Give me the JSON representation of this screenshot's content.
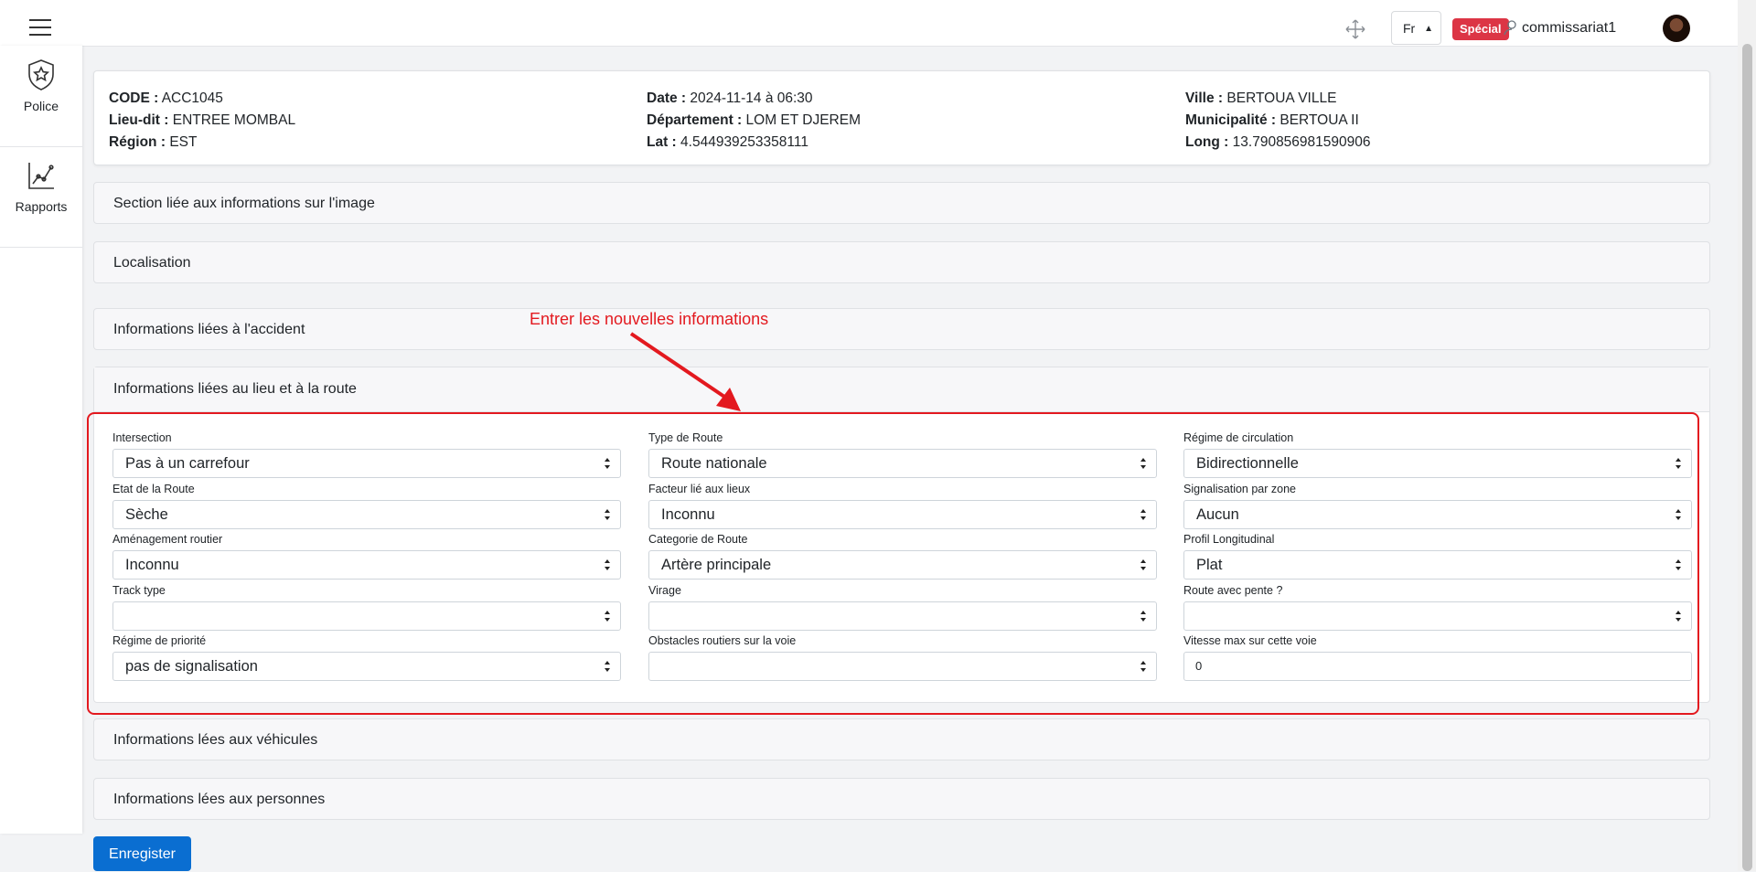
{
  "topbar": {
    "lang": "Fr",
    "badge": "Spécial",
    "username": "commissariat1"
  },
  "sidebar": {
    "items": [
      {
        "label": "Police",
        "icon": "police-badge-icon"
      },
      {
        "label": "Rapports",
        "icon": "chart-line-icon"
      }
    ]
  },
  "info": {
    "col1": [
      {
        "label": "CODE :",
        "value": "ACC1045"
      },
      {
        "label": "Lieu-dit :",
        "value": "ENTREE MOMBAL"
      },
      {
        "label": "Région :",
        "value": "EST"
      }
    ],
    "col2": [
      {
        "label": "Date :",
        "value": "2024-11-14 à 06:30"
      },
      {
        "label": "Département :",
        "value": "LOM ET DJEREM"
      },
      {
        "label": "Lat :",
        "value": "4.544939253358111"
      }
    ],
    "col3": [
      {
        "label": "Ville :",
        "value": "BERTOUA VILLE"
      },
      {
        "label": "Municipalité :",
        "value": "BERTOUA II"
      },
      {
        "label": "Long :",
        "value": "13.790856981590906"
      }
    ]
  },
  "sections": {
    "image": "Section liée aux informations sur l'image",
    "localisation": "Localisation",
    "accident": "Informations liées à l'accident",
    "lieu_route": "Informations liées au lieu et à la route",
    "vehicules": "Informations lées aux véhicules",
    "personnes": "Informations lées aux personnes"
  },
  "form": {
    "intersection": {
      "label": "Intersection",
      "value": "Pas à un carrefour"
    },
    "type_route": {
      "label": "Type de Route",
      "value": "Route nationale"
    },
    "regime_circulation": {
      "label": "Régime de circulation",
      "value": "Bidirectionnelle"
    },
    "etat_route": {
      "label": "Etat de la Route",
      "value": "Sèche"
    },
    "facteur_lieux": {
      "label": "Facteur lié aux lieux",
      "value": "Inconnu"
    },
    "signalisation_zone": {
      "label": "Signalisation par zone",
      "value": "Aucun"
    },
    "amenagement": {
      "label": "Aménagement routier",
      "value": "Inconnu"
    },
    "categorie_route": {
      "label": "Categorie de Route",
      "value": "Artère principale"
    },
    "profil": {
      "label": "Profil Longitudinal",
      "value": "Plat"
    },
    "track_type": {
      "label": "Track type",
      "value": ""
    },
    "virage": {
      "label": "Virage",
      "value": ""
    },
    "route_pente": {
      "label": "Route avec pente ?",
      "value": ""
    },
    "regime_priorite": {
      "label": "Régime de priorité",
      "value": "pas de signalisation"
    },
    "obstacles": {
      "label": "Obstacles routiers sur la voie",
      "value": ""
    },
    "vitesse_max": {
      "label": "Vitesse max sur cette voie",
      "value": "0"
    }
  },
  "annotation": {
    "text": "Entrer les nouvelles informations",
    "color": "#e3191f"
  },
  "actions": {
    "save": "Enregister"
  }
}
